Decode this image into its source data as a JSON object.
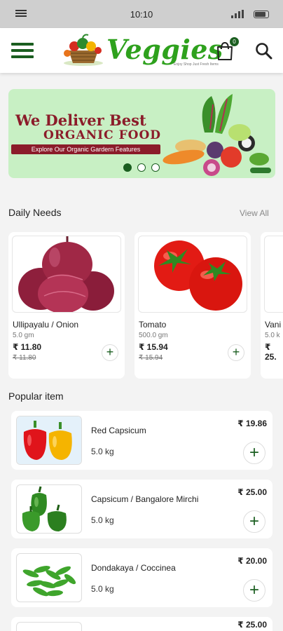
{
  "status_bar": {
    "time": "10:10"
  },
  "header": {
    "logo_text": "Veggies",
    "tagline": "Enjoy Shop Just Fresh Items",
    "cart_count": "0"
  },
  "banner": {
    "line1": "We Deliver Best",
    "line2": "ORGANIC FOOD",
    "line3": "Explore Our Organic Gardern Features"
  },
  "daily_needs": {
    "title": "Daily Needs",
    "view_all": "View All",
    "items": [
      {
        "name": "Ullipayalu / Onion",
        "weight": "5.0 gm",
        "price": "₹ 11.80",
        "mrp": "₹ 11.80"
      },
      {
        "name": "Tomato",
        "weight": "500.0 gm",
        "price": "₹ 15.94",
        "mrp": "₹ 15.94"
      },
      {
        "name": "Vani",
        "weight": "5.0 k",
        "price": "₹ 25."
      }
    ]
  },
  "popular": {
    "title": "Popular item",
    "items": [
      {
        "name": "Red Capsicum",
        "weight": "5.0 kg",
        "price": "₹ 19.86"
      },
      {
        "name": "Capsicum / Bangalore Mirchi",
        "weight": "5.0 kg",
        "price": "₹ 25.00"
      },
      {
        "name": "Dondakaya / Coccinea",
        "weight": "5.0 kg",
        "price": "₹ 20.00"
      },
      {
        "name": "",
        "weight": "",
        "price": "₹ 25.00"
      }
    ]
  },
  "add_label": "+",
  "colors": {
    "brand_green": "#1b5e20",
    "logo_green": "#2ea11d",
    "banner_bg": "#c8f0c4",
    "banner_text": "#8b1c2a"
  }
}
